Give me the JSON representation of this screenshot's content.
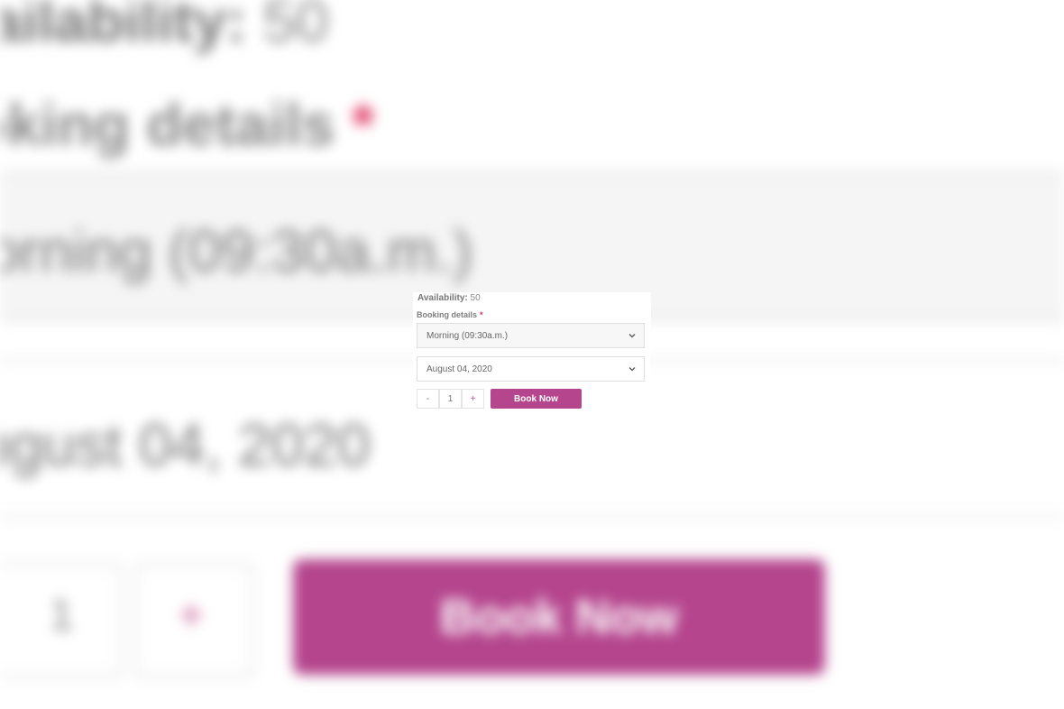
{
  "availability": {
    "label": "Availability:",
    "value": "50"
  },
  "booking": {
    "label": "Booking details",
    "required_marker": "*",
    "session_select": {
      "selected": "Morning (09:30a.m.)",
      "icon": "chevron-down-icon"
    },
    "date_select": {
      "selected": "August 04, 2020",
      "icon": "chevron-down-icon"
    }
  },
  "quantity": {
    "minus_label": "-",
    "value": "1",
    "plus_label": "+"
  },
  "actions": {
    "book_label": "Book Now"
  },
  "colors": {
    "accent": "#b5458d",
    "required": "#e0305e"
  }
}
